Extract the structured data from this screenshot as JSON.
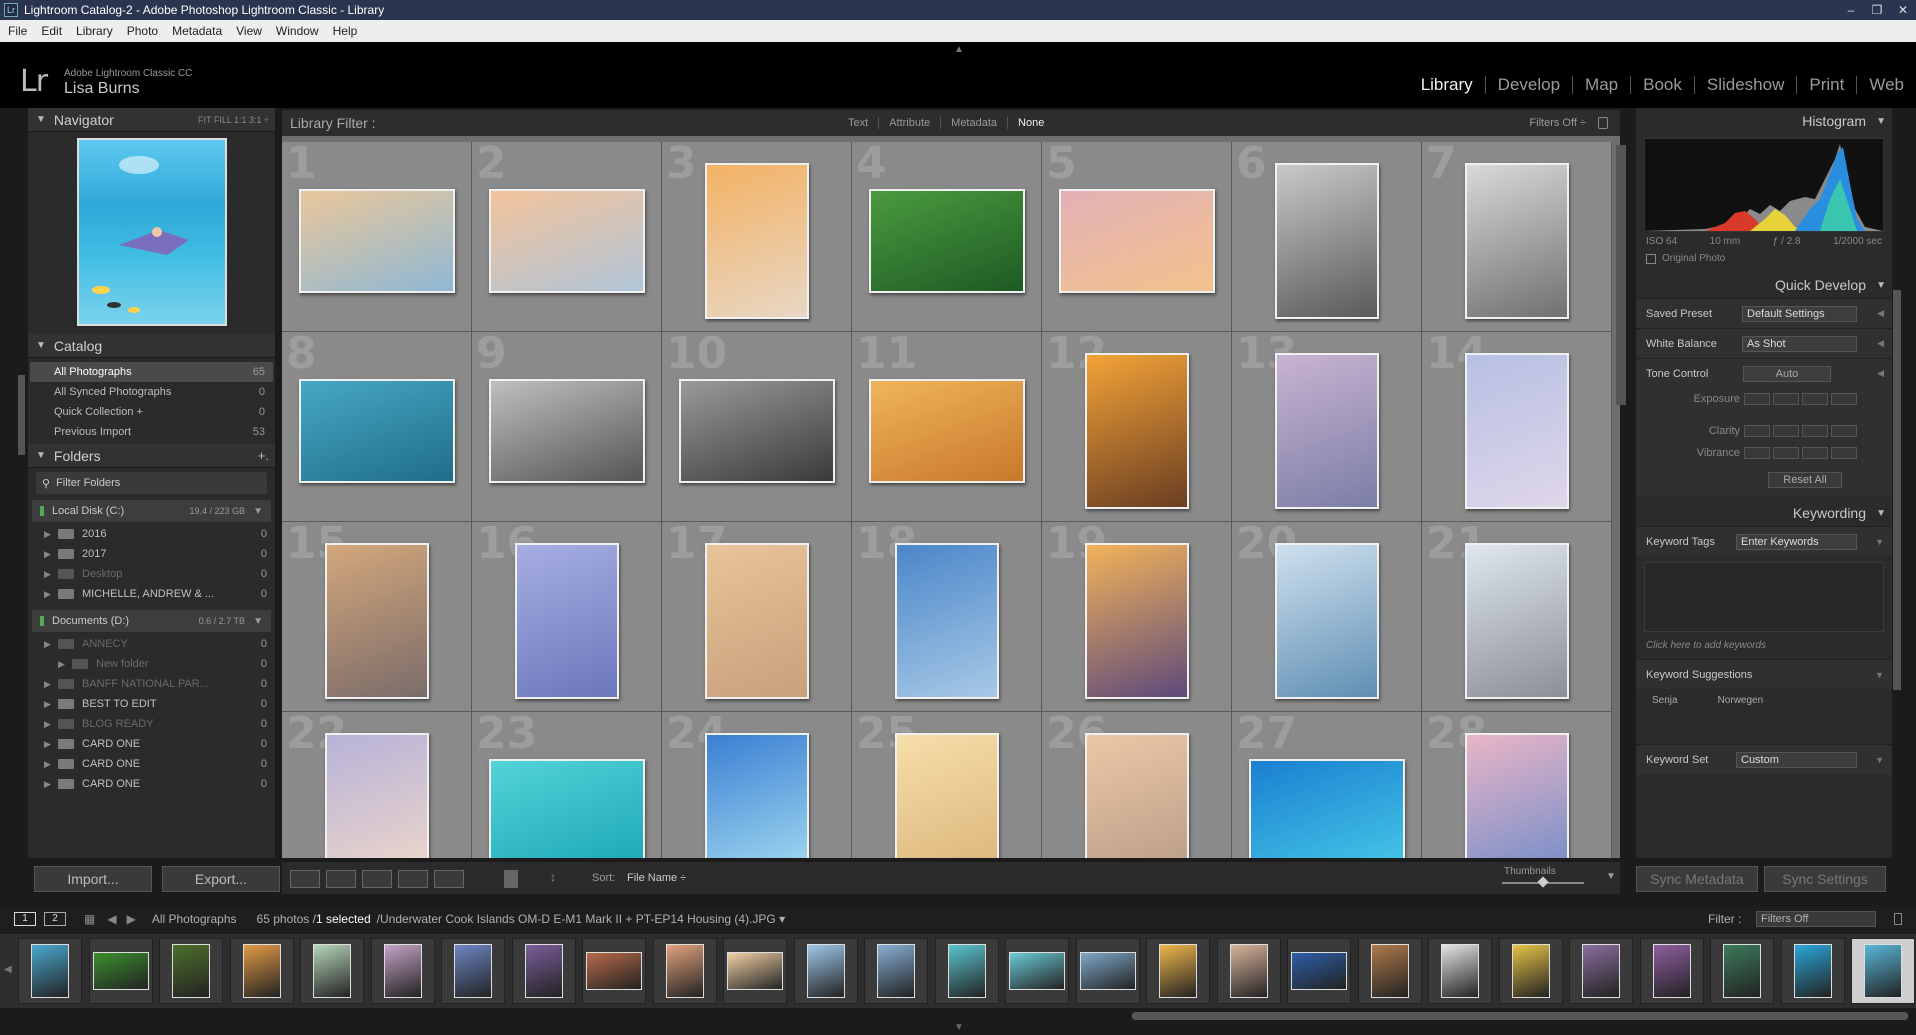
{
  "window": {
    "title": "Lightroom Catalog-2 - Adobe Photoshop Lightroom Classic - Library",
    "controls": [
      "–",
      "❐",
      "✕"
    ]
  },
  "menu": [
    "File",
    "Edit",
    "Library",
    "Photo",
    "Metadata",
    "View",
    "Window",
    "Help"
  ],
  "identity": {
    "logo": "Lr",
    "product": "Adobe Lightroom Classic CC",
    "user": "Lisa Burns"
  },
  "modules": [
    "Library",
    "Develop",
    "Map",
    "Book",
    "Slideshow",
    "Print",
    "Web"
  ],
  "active_module": "Library",
  "navigator": {
    "title": "Navigator",
    "options": "FIT   FILL   1:1   3:1 ÷"
  },
  "catalog": {
    "title": "Catalog",
    "items": [
      {
        "label": "All Photographs",
        "count": "65",
        "selected": true
      },
      {
        "label": "All Synced Photographs",
        "count": "0"
      },
      {
        "label": "Quick Collection +",
        "count": "0"
      },
      {
        "label": "Previous Import",
        "count": "53"
      }
    ]
  },
  "folders": {
    "title": "Folders",
    "add": "+.",
    "filter_placeholder": "Filter Folders",
    "volumes": [
      {
        "name": "Local Disk (C:)",
        "size": "19.4 / 223 GB",
        "items": [
          {
            "label": "2016",
            "count": "0",
            "dim": false
          },
          {
            "label": "2017",
            "count": "0",
            "dim": false
          },
          {
            "label": "Desktop",
            "count": "0",
            "dim": true
          },
          {
            "label": "MICHELLE, ANDREW & ...",
            "count": "0",
            "dim": false
          }
        ]
      },
      {
        "name": "Documents (D:)",
        "size": "0.6 / 2.7 TB",
        "items": [
          {
            "label": "ANNECY",
            "count": "0",
            "dim": true
          },
          {
            "label": "New folder",
            "count": "0",
            "dim": true
          },
          {
            "label": "BANFF NATIONAL PAR...",
            "count": "0",
            "dim": true
          },
          {
            "label": "BEST TO EDIT",
            "count": "0",
            "dim": false
          },
          {
            "label": "BLOG READY",
            "count": "0",
            "dim": true
          },
          {
            "label": "CARD ONE",
            "count": "0",
            "dim": false
          },
          {
            "label": "CARD ONE",
            "count": "0",
            "dim": false
          },
          {
            "label": "CARD ONE",
            "count": "0",
            "dim": false
          }
        ]
      }
    ]
  },
  "left_buttons": {
    "import": "Import...",
    "export": "Export..."
  },
  "library_filter": {
    "label": "Library Filter :",
    "options": [
      "Text",
      "Attribute",
      "Metadata",
      "None"
    ],
    "active": "None",
    "status": "Filters Off ÷"
  },
  "grid": {
    "photos": [
      {
        "n": "1",
        "o": "l",
        "c": "#e9c79a",
        "c2": "#8fb8d4"
      },
      {
        "n": "2",
        "o": "l",
        "c": "#f3c39b",
        "c2": "#b0c5d8"
      },
      {
        "n": "3",
        "o": "p",
        "c": "#f3b264",
        "c2": "#e8d7c4"
      },
      {
        "n": "4",
        "o": "l",
        "c": "#4a9b3f",
        "c2": "#1e5a24"
      },
      {
        "n": "5",
        "o": "l",
        "c": "#e4b0b6",
        "c2": "#f1c38c"
      },
      {
        "n": "6",
        "o": "p",
        "c": "#c9c9c9",
        "c2": "#5a5a5a"
      },
      {
        "n": "7",
        "o": "p",
        "c": "#d9d9d9",
        "c2": "#707070"
      },
      {
        "n": "8",
        "o": "l",
        "c": "#47a8c4",
        "c2": "#1f6e88"
      },
      {
        "n": "9",
        "o": "l",
        "c": "#bfbfbf",
        "c2": "#555555"
      },
      {
        "n": "10",
        "o": "l",
        "c": "#9a9a9a",
        "c2": "#3a3a3a"
      },
      {
        "n": "11",
        "o": "l",
        "c": "#efb55b",
        "c2": "#c9782a"
      },
      {
        "n": "12",
        "o": "p",
        "c": "#f3a337",
        "c2": "#6a3e22"
      },
      {
        "n": "13",
        "o": "p",
        "c": "#c9b3d1",
        "c2": "#7b7ea6"
      },
      {
        "n": "14",
        "o": "p",
        "c": "#b7c0e3",
        "c2": "#dfd6ea"
      },
      {
        "n": "15",
        "o": "p",
        "c": "#d3a77b",
        "c2": "#7b6c6a"
      },
      {
        "n": "16",
        "o": "p",
        "c": "#a7aee3",
        "c2": "#6b77bb"
      },
      {
        "n": "17",
        "o": "p",
        "c": "#e9c39a",
        "c2": "#c8a07a"
      },
      {
        "n": "18",
        "o": "p",
        "c": "#4b86c9",
        "c2": "#a7c9e6"
      },
      {
        "n": "19",
        "o": "p",
        "c": "#f2b35a",
        "c2": "#5e4a7a"
      },
      {
        "n": "20",
        "o": "p",
        "c": "#cfe0ee",
        "c2": "#5f8fb3"
      },
      {
        "n": "21",
        "o": "p",
        "c": "#dfe6ef",
        "c2": "#8b8f96"
      },
      {
        "n": "22",
        "o": "p",
        "c": "#b7b3d8",
        "c2": "#f1d8c9"
      },
      {
        "n": "23",
        "o": "l",
        "c": "#52d4d8",
        "c2": "#1ea8b7"
      },
      {
        "n": "24",
        "o": "p",
        "c": "#3b7fd3",
        "c2": "#a9e1f2"
      },
      {
        "n": "25",
        "o": "p",
        "c": "#f7deaa",
        "c2": "#d8b277"
      },
      {
        "n": "26",
        "o": "p",
        "c": "#ecc7a6",
        "c2": "#b59a85"
      },
      {
        "n": "27",
        "o": "l",
        "c": "#1a7fd0",
        "c2": "#43c3e6"
      },
      {
        "n": "28",
        "o": "p",
        "c": "#e9b5c7",
        "c2": "#6a8ac8"
      }
    ]
  },
  "toolbar": {
    "sort_label": "Sort:",
    "sort_value": "File Name ÷",
    "thumbs_label": "Thumbnails",
    "thumb_size": 0.5
  },
  "histogram": {
    "title": "Histogram",
    "iso": "ISO 64",
    "focal": "10 mm",
    "aperture": "ƒ / 2.8",
    "shutter": "1/2000 sec",
    "original": "Original Photo"
  },
  "quick_develop": {
    "title": "Quick Develop",
    "saved_preset_label": "Saved Preset",
    "saved_preset": "Default Settings",
    "wb_label": "White Balance",
    "wb": "As Shot",
    "tone_label": "Tone Control",
    "tone_btn": "Auto",
    "exposure": "Exposure",
    "clarity": "Clarity",
    "vibrance": "Vibrance",
    "reset": "Reset All"
  },
  "keywording": {
    "title": "Keywording",
    "tags_label": "Keyword Tags",
    "tags_value": "Enter Keywords",
    "hint": "Click here to add keywords",
    "suggestions_label": "Keyword Suggestions",
    "suggestions": [
      "Senja",
      "Norwegen"
    ],
    "set_label": "Keyword Set",
    "set_value": "Custom"
  },
  "right_buttons": {
    "sync_meta": "Sync Metadata",
    "sync_set": "Sync Settings"
  },
  "filmstrip_bar": {
    "screen1": "1",
    "screen2": "2",
    "source": "All Photographs",
    "count": "65 photos /",
    "selected": "1 selected",
    "path": "/Underwater Cook Islands OM-D E-M1 Mark II + PT-EP14 Housing (4).JPG ▾",
    "filter_label": "Filter :",
    "filter_value": "Filters Off"
  },
  "filmstrip": [
    {
      "c": "#4aa8d0",
      "o": "p"
    },
    {
      "c": "#3b8f2e",
      "o": "l"
    },
    {
      "c": "#4d6f2a",
      "o": "p"
    },
    {
      "c": "#e39a45",
      "o": "p"
    },
    {
      "c": "#b5d6b7",
      "o": "p"
    },
    {
      "c": "#c6a2c6",
      "o": "p"
    },
    {
      "c": "#6c86c4",
      "o": "p"
    },
    {
      "c": "#7a5e9a",
      "o": "p"
    },
    {
      "c": "#b86a4a",
      "o": "l"
    },
    {
      "c": "#e1a27c",
      "o": "p"
    },
    {
      "c": "#f2d2a6",
      "o": "l"
    },
    {
      "c": "#9ec7e8",
      "o": "p"
    },
    {
      "c": "#86afd5",
      "o": "p"
    },
    {
      "c": "#5ac5cf",
      "o": "p"
    },
    {
      "c": "#6bcbd6",
      "o": "l"
    },
    {
      "c": "#7ea9c9",
      "o": "l"
    },
    {
      "c": "#f0b64b",
      "o": "p"
    },
    {
      "c": "#d9b49a",
      "o": "p"
    },
    {
      "c": "#2c5fa8",
      "o": "l"
    },
    {
      "c": "#b07a4a",
      "o": "p"
    },
    {
      "c": "#e4e4e4",
      "o": "p"
    },
    {
      "c": "#e5c447",
      "o": "p"
    },
    {
      "c": "#8a6e9c",
      "o": "p"
    },
    {
      "c": "#8e5ea0",
      "o": "p"
    },
    {
      "c": "#3d7b5c",
      "o": "p"
    },
    {
      "c": "#2aa6d9",
      "o": "p"
    },
    {
      "c": "#59b7d9",
      "o": "p"
    }
  ],
  "colors": {
    "accent": "#f0f0f0",
    "panel": "#2b2b2b",
    "grid_bg": "#6f6f6f"
  }
}
